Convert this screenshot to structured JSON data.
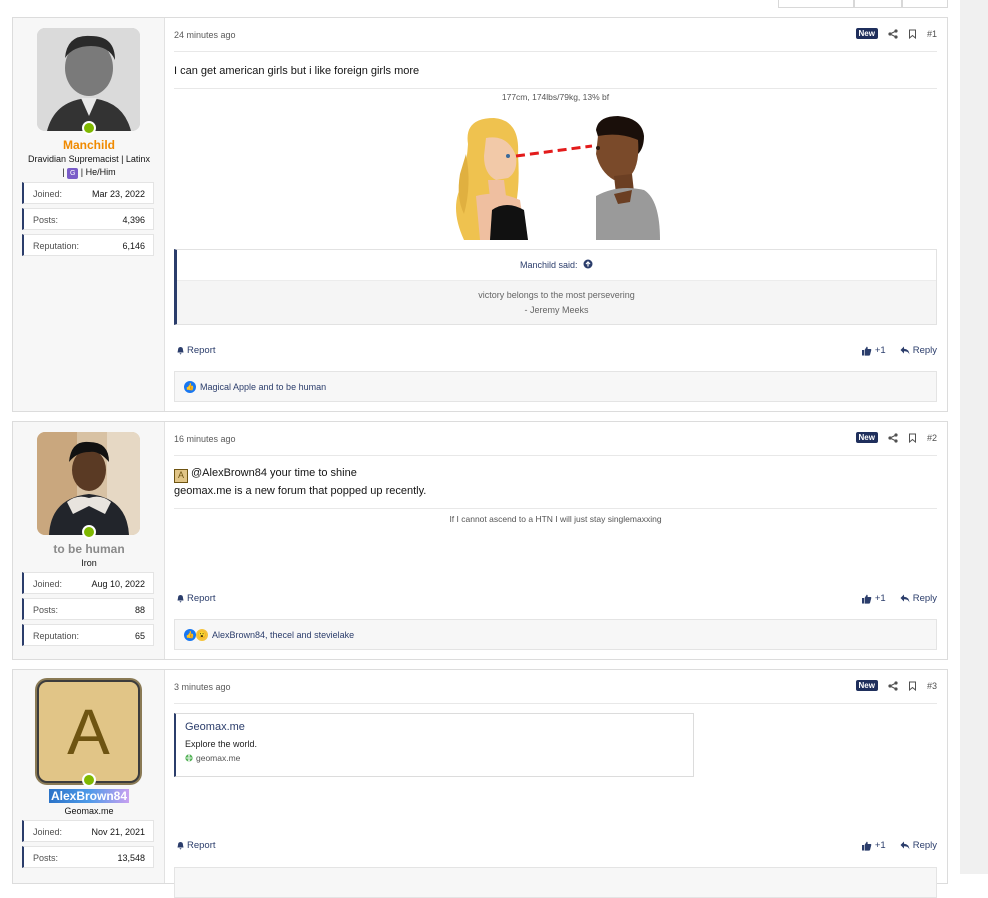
{
  "colors": {
    "accent": "#2b3d6b",
    "online": "#7fb800",
    "username_orange": "#f08a00",
    "new_badge": "#1f2f5c"
  },
  "posts": [
    {
      "user": {
        "name": "Manchild",
        "title_line1": "Dravidian Supremacist | Latinx",
        "title_line2": "| He/Him",
        "title_badge": "G",
        "stats": [
          {
            "label": "Joined:",
            "value": "Mar 23, 2022"
          },
          {
            "label": "Posts:",
            "value": "4,396"
          },
          {
            "label": "Reputation:",
            "value": "6,146"
          }
        ]
      },
      "date": "24 minutes ago",
      "new_label": "New",
      "number": "#1",
      "body": "I can get american girls but i like foreign girls more",
      "signature_top": "177cm, 174lbs/79kg, 13% bf",
      "quote": {
        "author": "Manchild said:",
        "line1": "victory belongs to the most persevering",
        "line2": "- Jeremy Meeks"
      },
      "report_label": "Report",
      "like_label": "+1",
      "reply_label": "Reply",
      "reactions_text": "Magical Apple and to be human"
    },
    {
      "user": {
        "name": "to be human",
        "title_line1": "Iron",
        "stats": [
          {
            "label": "Joined:",
            "value": "Aug 10, 2022"
          },
          {
            "label": "Posts:",
            "value": "88"
          },
          {
            "label": "Reputation:",
            "value": "65"
          }
        ]
      },
      "date": "16 minutes ago",
      "new_label": "New",
      "number": "#2",
      "mention_letter": "A",
      "body_line1": "@AlexBrown84 your time to shine",
      "body_line2": "geomax.me is a new forum that popped up recently.",
      "signature": "If I cannot ascend to a HTN I will just stay singlemaxxing",
      "report_label": "Report",
      "like_label": "+1",
      "reply_label": "Reply",
      "reactions_text": "AlexBrown84, thecel and stevielake"
    },
    {
      "user": {
        "name": "AlexBrown84",
        "avatar_letter": "A",
        "title_line1": "Geomax.me",
        "stats": [
          {
            "label": "Joined:",
            "value": "Nov 21, 2021"
          },
          {
            "label": "Posts:",
            "value": "13,548"
          }
        ]
      },
      "date": "3 minutes ago",
      "new_label": "New",
      "number": "#3",
      "embed": {
        "title": "Geomax.me",
        "description": "Explore the world.",
        "site": "geomax.me"
      },
      "report_label": "Report",
      "like_label": "+1",
      "reply_label": "Reply"
    }
  ]
}
